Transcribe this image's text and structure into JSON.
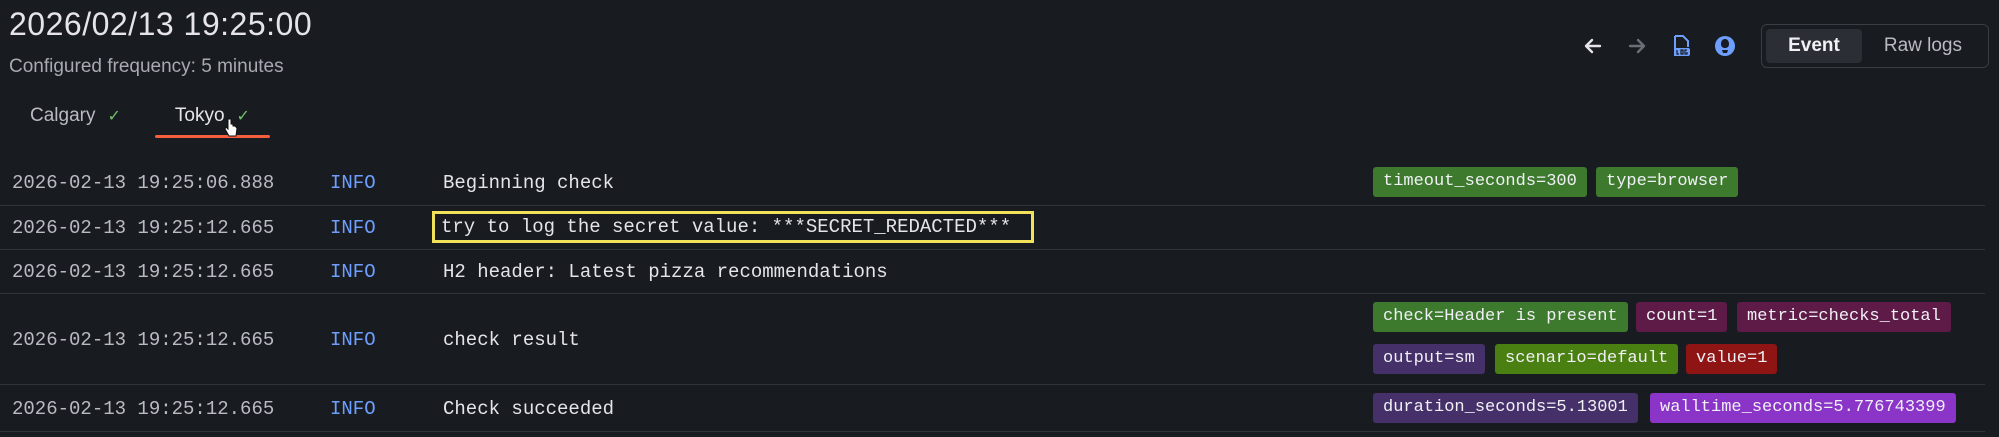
{
  "header": {
    "title": "2026/02/13 19:25:00",
    "frequency": "Configured frequency: 5 minutes"
  },
  "tabs": [
    {
      "label": "Calgary",
      "status": "✓"
    },
    {
      "label": "Tokyo",
      "status": "✓"
    }
  ],
  "toolbar": {
    "view_event": "Event",
    "view_raw": "Raw logs"
  },
  "colors": {
    "accent_tab": "#f55f3e",
    "info": "#6e9fff",
    "ok": "#73bf69",
    "highlight": "#f0e05a"
  },
  "logs": [
    {
      "ts": "2026-02-13 19:25:06.888",
      "level": "INFO",
      "msg": "Beginning check",
      "labels": [
        "timeout_seconds=300",
        "type=browser"
      ]
    },
    {
      "ts": "2026-02-13 19:25:12.665",
      "level": "INFO",
      "msg": "try to log the secret value: ***SECRET_REDACTED***",
      "labels": []
    },
    {
      "ts": "2026-02-13 19:25:12.665",
      "level": "INFO",
      "msg": "H2 header: Latest pizza recommendations",
      "labels": []
    },
    {
      "ts": "2026-02-13 19:25:12.665",
      "level": "INFO",
      "msg": "check result",
      "labels": [
        "check=Header is present",
        "count=1",
        "metric=checks_total",
        "output=sm",
        "scenario=default",
        "value=1"
      ]
    },
    {
      "ts": "2026-02-13 19:25:12.665",
      "level": "INFO",
      "msg": "Check succeeded",
      "labels": [
        "duration_seconds=5.13001",
        "walltime_seconds=5.776743399"
      ]
    }
  ]
}
